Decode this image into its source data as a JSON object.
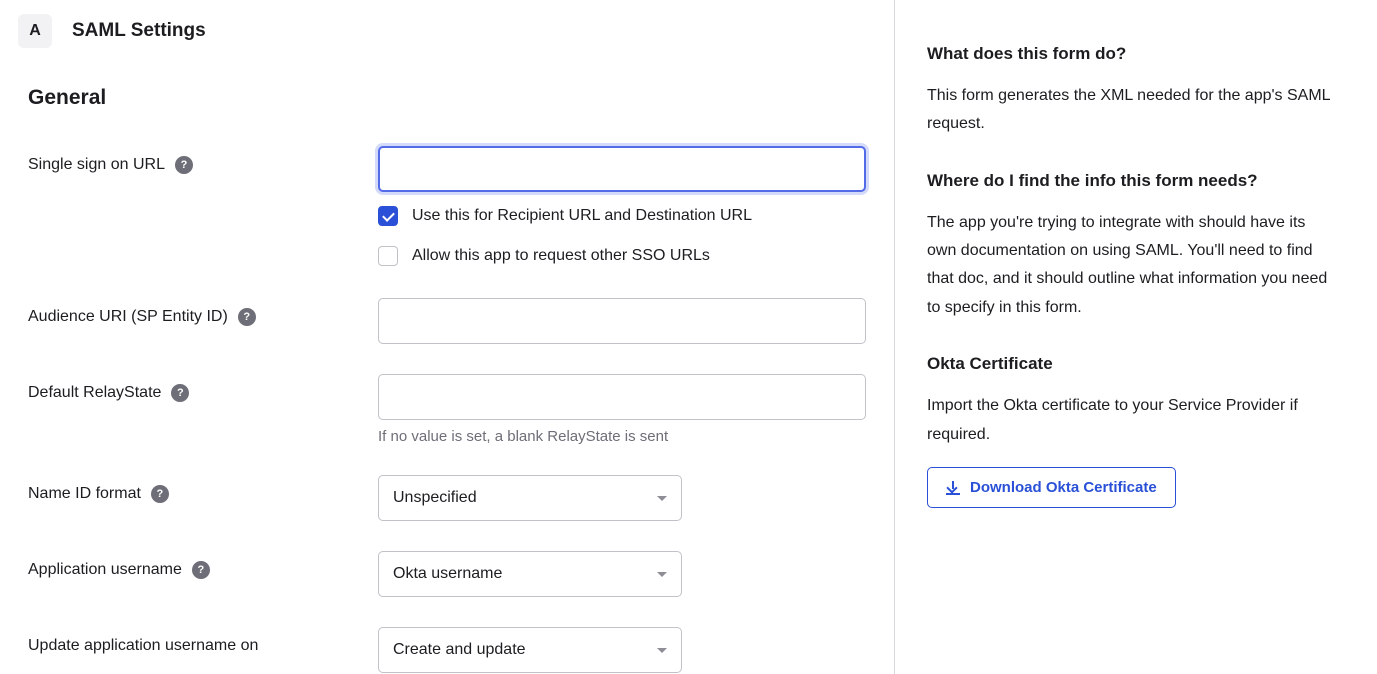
{
  "header": {
    "step_badge": "A",
    "title": "SAML Settings"
  },
  "section_title": "General",
  "fields": {
    "sso_url": {
      "label": "Single sign on URL",
      "value": ""
    },
    "use_recipient_destination": {
      "label": "Use this for Recipient URL and Destination URL",
      "checked": true
    },
    "allow_other_sso": {
      "label": "Allow this app to request other SSO URLs",
      "checked": false
    },
    "audience_uri": {
      "label": "Audience URI (SP Entity ID)",
      "value": ""
    },
    "default_relaystate": {
      "label": "Default RelayState",
      "value": "",
      "hint": "If no value is set, a blank RelayState is sent"
    },
    "name_id_format": {
      "label": "Name ID format",
      "selected": "Unspecified"
    },
    "application_username": {
      "label": "Application username",
      "selected": "Okta username"
    },
    "update_username_on": {
      "label": "Update application username on",
      "selected": "Create and update"
    }
  },
  "sidebar": {
    "what_heading": "What does this form do?",
    "what_text": "This form generates the XML needed for the app's SAML request.",
    "where_heading": "Where do I find the info this form needs?",
    "where_text": "The app you're trying to integrate with should have its own documentation on using SAML. You'll need to find that doc, and it should outline what information you need to specify in this form.",
    "cert_heading": "Okta Certificate",
    "cert_text": "Import the Okta certificate to your Service Provider if required.",
    "download_label": "Download Okta Certificate"
  }
}
